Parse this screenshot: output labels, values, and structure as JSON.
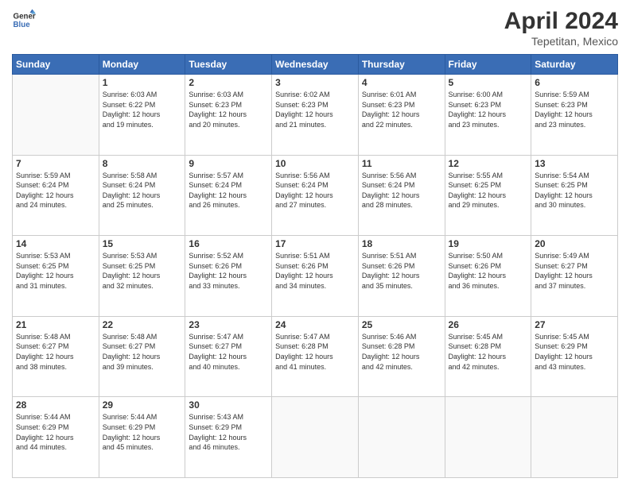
{
  "header": {
    "logo_line1": "General",
    "logo_line2": "Blue",
    "month_year": "April 2024",
    "location": "Tepetitan, Mexico"
  },
  "days_of_week": [
    "Sunday",
    "Monday",
    "Tuesday",
    "Wednesday",
    "Thursday",
    "Friday",
    "Saturday"
  ],
  "weeks": [
    [
      {
        "day": "",
        "info": ""
      },
      {
        "day": "1",
        "info": "Sunrise: 6:03 AM\nSunset: 6:22 PM\nDaylight: 12 hours\nand 19 minutes."
      },
      {
        "day": "2",
        "info": "Sunrise: 6:03 AM\nSunset: 6:23 PM\nDaylight: 12 hours\nand 20 minutes."
      },
      {
        "day": "3",
        "info": "Sunrise: 6:02 AM\nSunset: 6:23 PM\nDaylight: 12 hours\nand 21 minutes."
      },
      {
        "day": "4",
        "info": "Sunrise: 6:01 AM\nSunset: 6:23 PM\nDaylight: 12 hours\nand 22 minutes."
      },
      {
        "day": "5",
        "info": "Sunrise: 6:00 AM\nSunset: 6:23 PM\nDaylight: 12 hours\nand 23 minutes."
      },
      {
        "day": "6",
        "info": "Sunrise: 5:59 AM\nSunset: 6:23 PM\nDaylight: 12 hours\nand 23 minutes."
      }
    ],
    [
      {
        "day": "7",
        "info": "Sunrise: 5:59 AM\nSunset: 6:24 PM\nDaylight: 12 hours\nand 24 minutes."
      },
      {
        "day": "8",
        "info": "Sunrise: 5:58 AM\nSunset: 6:24 PM\nDaylight: 12 hours\nand 25 minutes."
      },
      {
        "day": "9",
        "info": "Sunrise: 5:57 AM\nSunset: 6:24 PM\nDaylight: 12 hours\nand 26 minutes."
      },
      {
        "day": "10",
        "info": "Sunrise: 5:56 AM\nSunset: 6:24 PM\nDaylight: 12 hours\nand 27 minutes."
      },
      {
        "day": "11",
        "info": "Sunrise: 5:56 AM\nSunset: 6:24 PM\nDaylight: 12 hours\nand 28 minutes."
      },
      {
        "day": "12",
        "info": "Sunrise: 5:55 AM\nSunset: 6:25 PM\nDaylight: 12 hours\nand 29 minutes."
      },
      {
        "day": "13",
        "info": "Sunrise: 5:54 AM\nSunset: 6:25 PM\nDaylight: 12 hours\nand 30 minutes."
      }
    ],
    [
      {
        "day": "14",
        "info": "Sunrise: 5:53 AM\nSunset: 6:25 PM\nDaylight: 12 hours\nand 31 minutes."
      },
      {
        "day": "15",
        "info": "Sunrise: 5:53 AM\nSunset: 6:25 PM\nDaylight: 12 hours\nand 32 minutes."
      },
      {
        "day": "16",
        "info": "Sunrise: 5:52 AM\nSunset: 6:26 PM\nDaylight: 12 hours\nand 33 minutes."
      },
      {
        "day": "17",
        "info": "Sunrise: 5:51 AM\nSunset: 6:26 PM\nDaylight: 12 hours\nand 34 minutes."
      },
      {
        "day": "18",
        "info": "Sunrise: 5:51 AM\nSunset: 6:26 PM\nDaylight: 12 hours\nand 35 minutes."
      },
      {
        "day": "19",
        "info": "Sunrise: 5:50 AM\nSunset: 6:26 PM\nDaylight: 12 hours\nand 36 minutes."
      },
      {
        "day": "20",
        "info": "Sunrise: 5:49 AM\nSunset: 6:27 PM\nDaylight: 12 hours\nand 37 minutes."
      }
    ],
    [
      {
        "day": "21",
        "info": "Sunrise: 5:48 AM\nSunset: 6:27 PM\nDaylight: 12 hours\nand 38 minutes."
      },
      {
        "day": "22",
        "info": "Sunrise: 5:48 AM\nSunset: 6:27 PM\nDaylight: 12 hours\nand 39 minutes."
      },
      {
        "day": "23",
        "info": "Sunrise: 5:47 AM\nSunset: 6:27 PM\nDaylight: 12 hours\nand 40 minutes."
      },
      {
        "day": "24",
        "info": "Sunrise: 5:47 AM\nSunset: 6:28 PM\nDaylight: 12 hours\nand 41 minutes."
      },
      {
        "day": "25",
        "info": "Sunrise: 5:46 AM\nSunset: 6:28 PM\nDaylight: 12 hours\nand 42 minutes."
      },
      {
        "day": "26",
        "info": "Sunrise: 5:45 AM\nSunset: 6:28 PM\nDaylight: 12 hours\nand 42 minutes."
      },
      {
        "day": "27",
        "info": "Sunrise: 5:45 AM\nSunset: 6:29 PM\nDaylight: 12 hours\nand 43 minutes."
      }
    ],
    [
      {
        "day": "28",
        "info": "Sunrise: 5:44 AM\nSunset: 6:29 PM\nDaylight: 12 hours\nand 44 minutes."
      },
      {
        "day": "29",
        "info": "Sunrise: 5:44 AM\nSunset: 6:29 PM\nDaylight: 12 hours\nand 45 minutes."
      },
      {
        "day": "30",
        "info": "Sunrise: 5:43 AM\nSunset: 6:29 PM\nDaylight: 12 hours\nand 46 minutes."
      },
      {
        "day": "",
        "info": ""
      },
      {
        "day": "",
        "info": ""
      },
      {
        "day": "",
        "info": ""
      },
      {
        "day": "",
        "info": ""
      }
    ]
  ]
}
